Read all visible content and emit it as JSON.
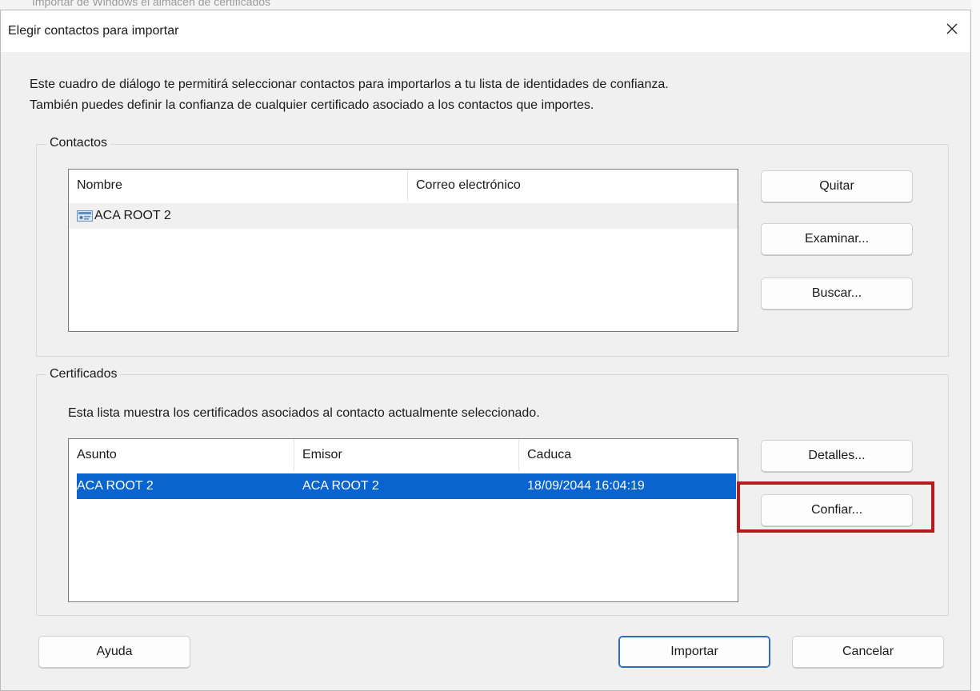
{
  "background_window": {
    "text": "Importar de Windows el almacén de certificados"
  },
  "dialog": {
    "title": "Elegir contactos para importar",
    "close_icon": "close-icon",
    "intro_line1": "Este cuadro de diálogo te permitirá seleccionar contactos para importarlos a tu lista de identidades de confianza.",
    "intro_line2": "También puedes definir la confianza de cualquier certificado asociado a los contactos que importes."
  },
  "contacts": {
    "group_label": "Contactos",
    "columns": [
      "Nombre",
      "Correo electrónico"
    ],
    "rows": [
      {
        "name": "ACA ROOT 2",
        "email": "",
        "icon": "contact-card-icon"
      }
    ],
    "buttons": {
      "remove": "Quitar",
      "browse": "Examinar...",
      "search": "Buscar..."
    }
  },
  "certificates": {
    "group_label": "Certificados",
    "description": "Esta lista muestra los certificados asociados al contacto actualmente seleccionado.",
    "columns": [
      "Asunto",
      "Emisor",
      "Caduca"
    ],
    "rows": [
      {
        "subject": "ACA ROOT 2",
        "issuer": "ACA ROOT 2",
        "expires": "18/09/2044 16:04:19",
        "selected": true
      }
    ],
    "buttons": {
      "details": "Detalles...",
      "trust": "Confiar..."
    }
  },
  "footer": {
    "help": "Ayuda",
    "import": "Importar",
    "cancel": "Cancelar"
  },
  "colors": {
    "selection": "#0a64d0",
    "highlight_box": "#b71c1c",
    "primary_border": "#2b6cc4"
  }
}
